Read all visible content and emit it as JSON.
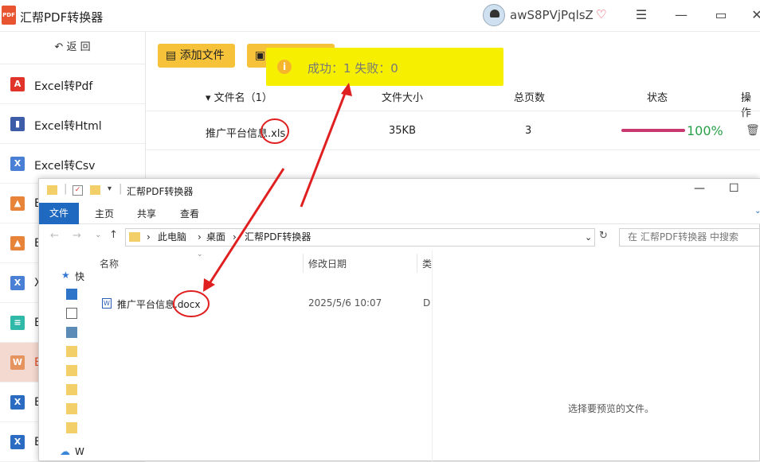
{
  "app": {
    "title": "汇帮PDF转换器",
    "logo_text": "PDF",
    "username": "awS8PVjPqlsZ"
  },
  "sidebar": {
    "back_label": "返 回",
    "items": [
      {
        "label": "Excel转Pdf",
        "icon": "pdf-icon",
        "color": "#e0342a",
        "glyph": "A"
      },
      {
        "label": "Excel转Html",
        "icon": "html-book-icon",
        "color": "#3d5da8",
        "glyph": "▮"
      },
      {
        "label": "Excel转Csv",
        "icon": "csv-icon",
        "color": "#4a7fd6",
        "glyph": "X"
      },
      {
        "label": "E",
        "icon": "image-icon",
        "color": "#e8843a",
        "glyph": "▲"
      },
      {
        "label": "E",
        "icon": "image-icon",
        "color": "#e8843a",
        "glyph": "▲"
      },
      {
        "label": "X",
        "icon": "excel-x-icon",
        "color": "#4a7fd6",
        "glyph": "X"
      },
      {
        "label": "E",
        "icon": "text-doc-icon",
        "color": "#30b8a8",
        "glyph": "≡"
      },
      {
        "label": "E",
        "icon": "word-icon",
        "color": "#e5935f",
        "glyph": "W"
      },
      {
        "label": "E",
        "icon": "excel-icon",
        "color": "#2b6bc2",
        "glyph": "X"
      },
      {
        "label": "E",
        "icon": "excel-icon",
        "color": "#2b6bc2",
        "glyph": "X"
      }
    ]
  },
  "toolbar": {
    "add_file": "添加文件"
  },
  "table": {
    "headers": {
      "name": "▾ 文件名（1）",
      "size": "文件大小",
      "pages": "总页数",
      "status": "状态",
      "ops": "操作"
    },
    "row": {
      "name": "推广平台信息.xls",
      "size": "35KB",
      "pages": "3",
      "percent": "100%",
      "progress": 1.0
    }
  },
  "toast": {
    "message": "成功：1   失败：0"
  },
  "explorer": {
    "title": "汇帮PDF转换器",
    "ribbon": [
      "文件",
      "主页",
      "共享",
      "查看"
    ],
    "path": [
      "此电脑",
      "桌面",
      "汇帮PDF转换器"
    ],
    "search_placeholder": "在 汇帮PDF转换器 中搜索",
    "columns": {
      "name": "名称",
      "date": "修改日期",
      "type": "类"
    },
    "file": {
      "name": "推广平台信息.docx",
      "date": "2025/5/6 10:07",
      "type": "D"
    },
    "nav": {
      "quick": "快",
      "cloud": "W"
    },
    "preview_text": "选择要预览的文件。"
  }
}
